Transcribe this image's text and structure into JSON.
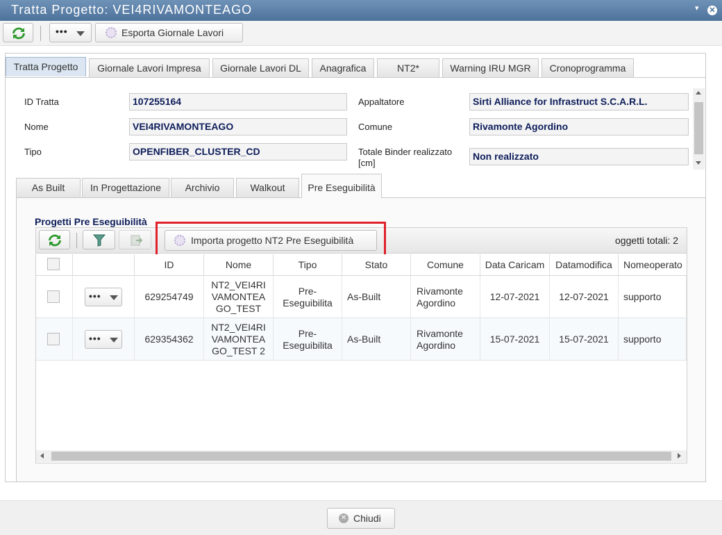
{
  "window": {
    "title": "Tratta Progetto: VEI4RIVAMONTEAGO",
    "minimize": "▾",
    "close": "✕"
  },
  "toolbar": {
    "more": "•••",
    "export_label": "Esporta Giornale Lavori"
  },
  "tabs": [
    "Tratta Progetto",
    "Giornale Lavori Impresa",
    "Giornale Lavori DL",
    "Anagrafica",
    "NT2*",
    "Warning IRU MGR",
    "Cronoprogramma"
  ],
  "form": {
    "id_label": "ID Tratta",
    "id_value": "107255164",
    "nome_label": "Nome",
    "nome_value": "VEI4RIVAMONTEAGO",
    "tipo_label": "Tipo",
    "tipo_value": "OPENFIBER_CLUSTER_CD",
    "appaltatore_label": "Appaltatore",
    "appaltatore_value": "Sirti Alliance for Infrastruct S.C.A.R.L.",
    "comune_label": "Comune",
    "comune_value": "Rivamonte Agordino",
    "binder_label": "Totale Binder realizzato [cm]",
    "binder_value": "Non realizzato"
  },
  "subtabs": [
    "As Built",
    "In Progettazione",
    "Archivio",
    "Walkout",
    "Pre Eseguibilità"
  ],
  "section": {
    "title": "Progetti Pre Eseguibilità",
    "import_label": "Importa progetto NT2 Pre Eseguibilità",
    "total": "oggetti totali: 2"
  },
  "columns": [
    "ID",
    "Nome",
    "Tipo",
    "Stato",
    "Comune",
    "Data Caricam",
    "Datamodifica",
    "Nomeoperato"
  ],
  "rows": [
    {
      "id": "629254749",
      "nome": "NT2_VEI4RI\nVAMONTEA\nGO_TEST",
      "tipo": "Pre-\nEseguibilita",
      "stato": "As-Built",
      "comune": "Rivamonte\nAgordino",
      "data_caricamento": "12-07-2021",
      "datamodifica": "12-07-2021",
      "operatore": "supporto"
    },
    {
      "id": "629354362",
      "nome": "NT2_VEI4RI\nVAMONTEA\nGO_TEST 2",
      "tipo": "Pre-\nEseguibilita",
      "stato": "As-Built",
      "comune": "Rivamonte\nAgordino",
      "data_caricamento": "15-07-2021",
      "datamodifica": "15-07-2021",
      "operatore": "supporto"
    }
  ],
  "footer": {
    "close_label": "Chiudi"
  }
}
